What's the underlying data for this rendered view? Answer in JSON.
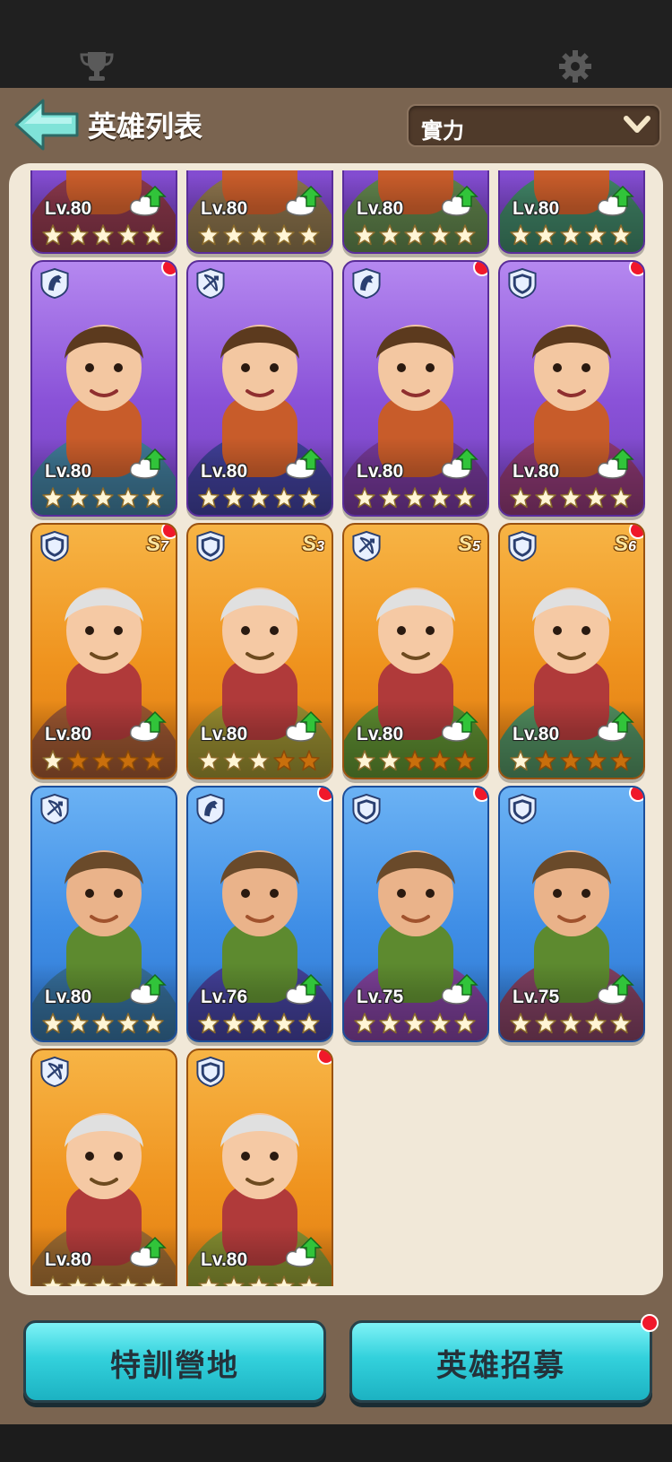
{
  "header": {
    "title": "英雄列表",
    "sort": {
      "selected": "實力"
    }
  },
  "top_bar": {
    "left_icon": "trophy-icon",
    "right_icon": "gear-icon"
  },
  "roles": {
    "cavalry": "horse-icon",
    "archer": "bow-icon",
    "infantry": "shield-icon"
  },
  "colors": {
    "purple_card": "#8a52d8",
    "orange_card": "#ef931e",
    "blue_card": "#3f8ee6",
    "panel_bg": "#7a6450",
    "list_bg": "#f1e8d8",
    "red_dot": "#f0182a",
    "button": "#33d1dc"
  },
  "heroes": [
    {
      "level": "Lv.80",
      "stars": 5,
      "rarity": "purple",
      "role": "",
      "red_dot": false,
      "upgrade": true,
      "grade": ""
    },
    {
      "level": "Lv.80",
      "stars": 5,
      "rarity": "purple",
      "role": "",
      "red_dot": false,
      "upgrade": true,
      "grade": ""
    },
    {
      "level": "Lv.80",
      "stars": 5,
      "rarity": "purple",
      "role": "",
      "red_dot": false,
      "upgrade": true,
      "grade": ""
    },
    {
      "level": "Lv.80",
      "stars": 5,
      "rarity": "purple",
      "role": "",
      "red_dot": false,
      "upgrade": true,
      "grade": ""
    },
    {
      "level": "Lv.80",
      "stars": 5,
      "rarity": "purple",
      "role": "cavalry",
      "red_dot": true,
      "upgrade": true,
      "grade": ""
    },
    {
      "level": "Lv.80",
      "stars": 5,
      "rarity": "purple",
      "role": "archer",
      "red_dot": false,
      "upgrade": true,
      "grade": ""
    },
    {
      "level": "Lv.80",
      "stars": 5,
      "rarity": "purple",
      "role": "cavalry",
      "red_dot": true,
      "upgrade": true,
      "grade": ""
    },
    {
      "level": "Lv.80",
      "stars": 5,
      "rarity": "purple",
      "role": "infantry",
      "red_dot": true,
      "upgrade": true,
      "grade": ""
    },
    {
      "level": "Lv.80",
      "stars": 1,
      "rarity": "orange",
      "role": "infantry",
      "red_dot": true,
      "upgrade": true,
      "grade": "7"
    },
    {
      "level": "Lv.80",
      "stars": 3,
      "rarity": "orange",
      "role": "infantry",
      "red_dot": false,
      "upgrade": true,
      "grade": "3"
    },
    {
      "level": "Lv.80",
      "stars": 2,
      "rarity": "orange",
      "role": "archer",
      "red_dot": false,
      "upgrade": true,
      "grade": "5"
    },
    {
      "level": "Lv.80",
      "stars": 1,
      "rarity": "orange",
      "role": "infantry",
      "red_dot": true,
      "upgrade": true,
      "grade": "6"
    },
    {
      "level": "Lv.80",
      "stars": 5,
      "rarity": "blue",
      "role": "archer",
      "red_dot": false,
      "upgrade": true,
      "grade": ""
    },
    {
      "level": "Lv.76",
      "stars": 5,
      "rarity": "blue",
      "role": "cavalry",
      "red_dot": true,
      "upgrade": true,
      "grade": ""
    },
    {
      "level": "Lv.75",
      "stars": 5,
      "rarity": "blue",
      "role": "infantry",
      "red_dot": true,
      "upgrade": true,
      "grade": ""
    },
    {
      "level": "Lv.75",
      "stars": 5,
      "rarity": "blue",
      "role": "infantry",
      "red_dot": true,
      "upgrade": true,
      "grade": ""
    },
    {
      "level": "Lv.80",
      "stars": 5,
      "rarity": "orange",
      "role": "archer",
      "red_dot": false,
      "upgrade": true,
      "grade": ""
    },
    {
      "level": "Lv.80",
      "stars": 5,
      "rarity": "orange",
      "role": "infantry",
      "red_dot": true,
      "upgrade": true,
      "grade": ""
    }
  ],
  "buttons": {
    "training_camp": "特訓營地",
    "recruit": "英雄招募",
    "recruit_red_dot": true
  }
}
